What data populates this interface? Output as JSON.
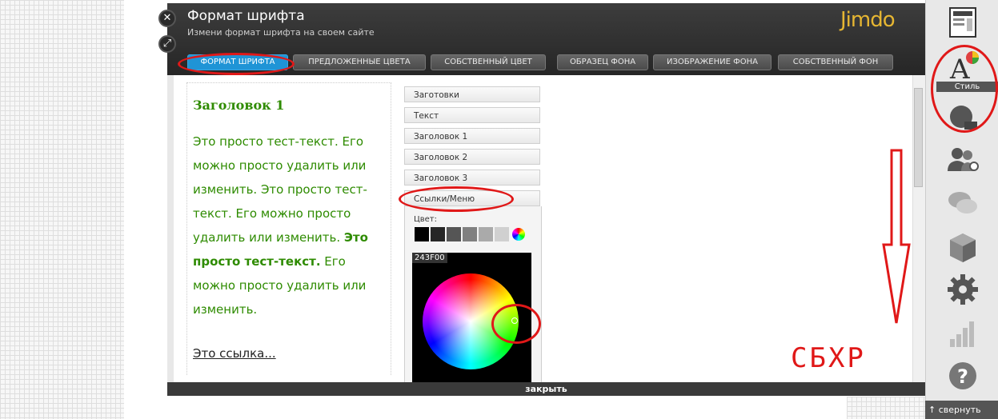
{
  "dialog": {
    "title": "Формат шрифта",
    "subtitle": "Измени формат шрифта на своем сайте",
    "logo": "Jimdo",
    "close_icon": "close-icon",
    "expand_icon": "expand-icon",
    "footer_label": "закрыть"
  },
  "tabs": [
    {
      "label": "Формат шрифта",
      "active": true
    },
    {
      "label": "Предложенные цвета",
      "active": false
    },
    {
      "label": "Собственный цвет",
      "active": false
    },
    {
      "label": "Образец фона",
      "active": false
    },
    {
      "label": "Изображение фона",
      "active": false
    },
    {
      "label": "Собственный фон",
      "active": false
    }
  ],
  "preview": {
    "heading": "Заголовок 1",
    "text_part1": "Это просто тест-текст. Его можно просто удалить или изменить. Это просто тест-текст. Его можно просто удалить или изменить. ",
    "text_bold": "Это просто тест-текст.",
    "text_part2": " Его можно просто удалить или изменить.",
    "link": "Это ссылка..."
  },
  "accordion": {
    "items": [
      "Заготовки",
      "Текст",
      "Заголовок 1",
      "Заголовок 2",
      "Заголовок 3",
      "Ссылки/Меню"
    ],
    "color_label": "Цвет:",
    "swatches": [
      "#000000",
      "#262626",
      "#555555",
      "#808080",
      "#aaaaaa",
      "#d0d0d0",
      "#eeeeee"
    ],
    "hex_value": "243F00"
  },
  "sidebar": {
    "style_label": "Стиль",
    "collapse_label": "свернуть",
    "icons": [
      "layout-icon",
      "style-icon",
      "megaphone-icon",
      "users-icon",
      "chat-icon",
      "package-icon",
      "settings-icon",
      "stats-icon",
      "help-icon"
    ],
    "help_symbol": "?"
  },
  "annotation": {
    "text": "СБХР",
    "accent_color": "#e01818"
  },
  "colors": {
    "preview_text": "#2e8b00",
    "active_tab": "#1f94d6",
    "logo": "#e6b632"
  }
}
